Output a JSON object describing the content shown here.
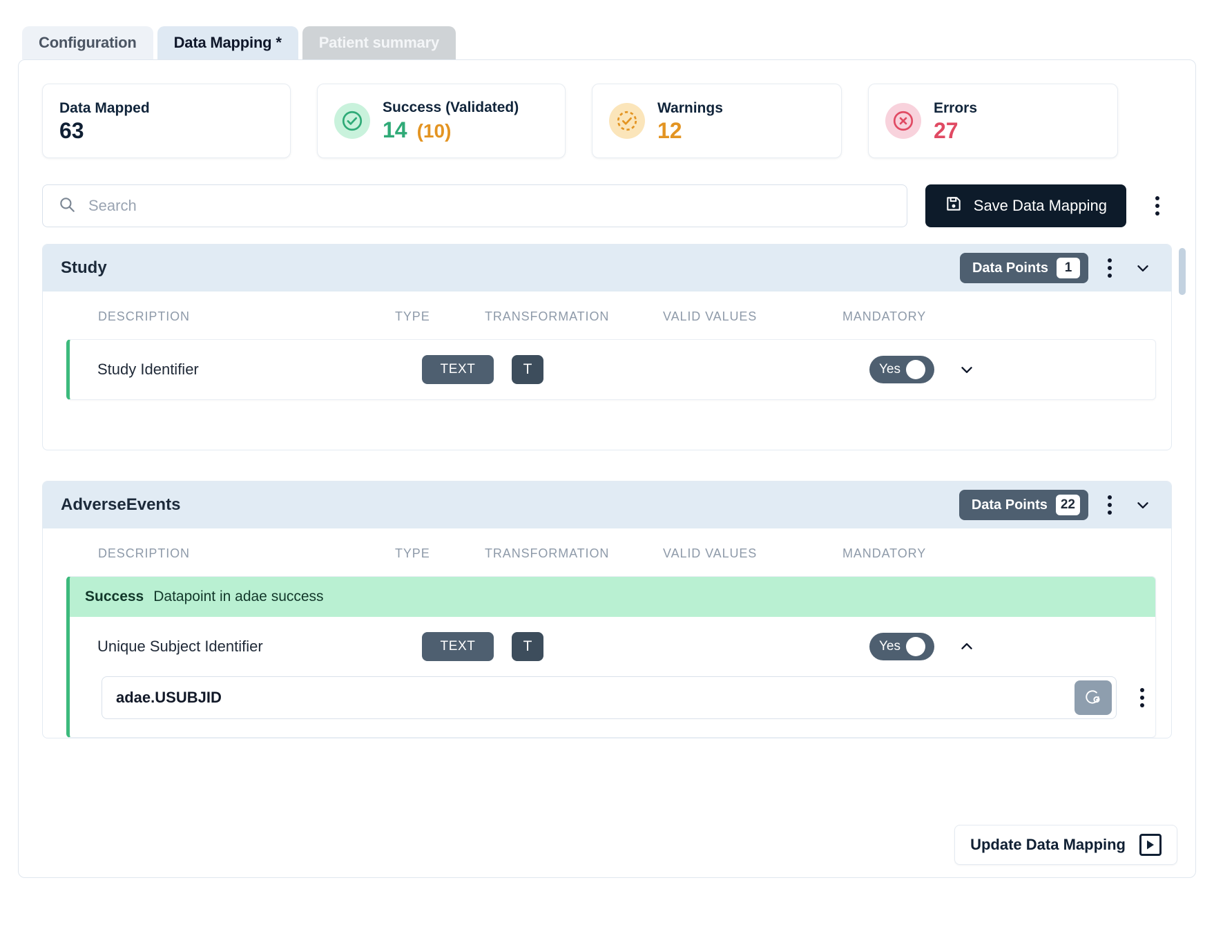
{
  "tabs": [
    {
      "label": "Configuration",
      "state": "inactive"
    },
    {
      "label": "Data Mapping *",
      "state": "active"
    },
    {
      "label": "Patient summary",
      "state": "disabled"
    }
  ],
  "stats": [
    {
      "label": "Data Mapped",
      "value": "63",
      "sub": "",
      "icon": "none",
      "color": "#0f1f33"
    },
    {
      "label": "Success (Validated)",
      "value": "14",
      "sub": "(10)",
      "icon": "check-circle-icon",
      "color": "#2faa77"
    },
    {
      "label": "Warnings",
      "value": "12",
      "sub": "",
      "icon": "warning-dashed-check-icon",
      "color": "#e39422"
    },
    {
      "label": "Errors",
      "value": "27",
      "sub": "",
      "icon": "error-x-circle-icon",
      "color": "#e04a63"
    }
  ],
  "search": {
    "value": "",
    "placeholder": "Search"
  },
  "toolbar": {
    "save_label": "Save Data Mapping",
    "more_label": "More options"
  },
  "table_headers": {
    "description": "DESCRIPTION",
    "type": "TYPE",
    "transformation": "TRANSFORMATION",
    "valid_values": "VALID VALUES",
    "mandatory": "MANDATORY"
  },
  "groups": [
    {
      "title": "Study",
      "data_points_label": "Data Points",
      "data_points_count": "1",
      "rows": [
        {
          "description": "Study Identifier",
          "type": "TEXT",
          "transformation": "T",
          "valid_values": "",
          "mandatory": "Yes",
          "expanded": false
        }
      ]
    },
    {
      "title": "AdverseEvents",
      "data_points_label": "Data Points",
      "data_points_count": "22",
      "banner": {
        "status": "Success",
        "message": "Datapoint in adae success"
      },
      "rows": [
        {
          "description": "Unique Subject Identifier",
          "type": "TEXT",
          "transformation": "T",
          "valid_values": "",
          "mandatory": "Yes",
          "expanded": true,
          "mapping_value": "adae.USUBJID"
        }
      ]
    }
  ],
  "footer": {
    "update_label": "Update Data Mapping"
  },
  "colors": {
    "accent_dark": "#0d1b2a",
    "group_header": "#e1ebf4",
    "success": "#2faa77",
    "success_banner": "#b9f0d2",
    "warning": "#e39422",
    "error": "#e04a63",
    "pill": "#4e5f70"
  }
}
